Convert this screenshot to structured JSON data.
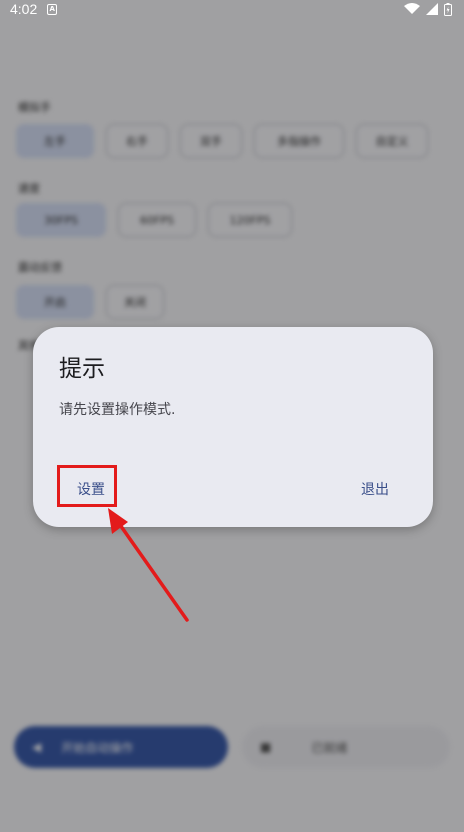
{
  "status_bar": {
    "time": "4:02",
    "notification_icon": "a-notification-icon",
    "wifi_icon": "wifi-icon",
    "signal_icon": "signal-icon",
    "battery_icon": "battery-icon"
  },
  "background": {
    "sections": [
      {
        "label": "模拟手",
        "chips": [
          "左手",
          "右手",
          "双手",
          "多指操作",
          "自定义"
        ],
        "selected": 0
      },
      {
        "label": "速度",
        "chips": [
          "30FPS",
          "60FPS",
          "120FPS"
        ],
        "selected": 0
      },
      {
        "label": "震动反馈",
        "chips": [
          "开启",
          "关闭"
        ],
        "selected": 0
      },
      {
        "label": "其他"
      }
    ],
    "primary_button": "开始自动操作",
    "secondary_button": "已就绪"
  },
  "dialog": {
    "title": "提示",
    "message": "请先设置操作模式.",
    "setup_button": "设置",
    "exit_button": "退出"
  },
  "annotation": {
    "highlight_color": "#e31b1b",
    "target": "设置"
  }
}
